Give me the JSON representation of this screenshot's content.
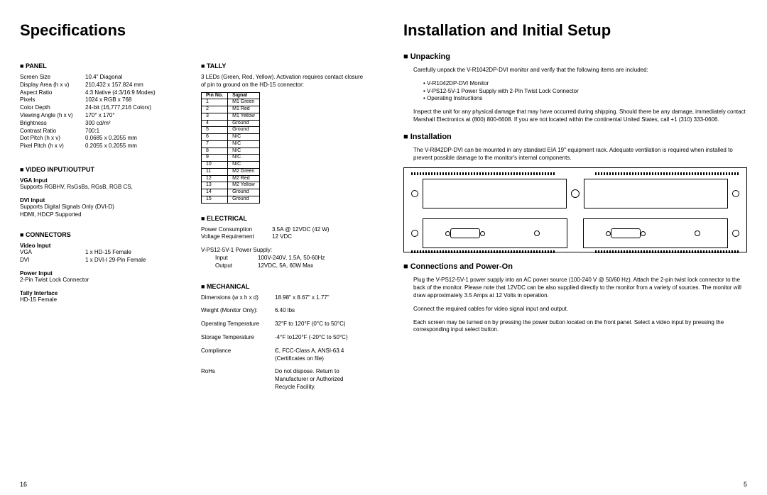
{
  "left": {
    "title": "Specifications",
    "page_num": "16",
    "panel": {
      "heading": "PANEL",
      "rows": [
        {
          "label": "Screen Size",
          "val": "10.4\" Diagonal"
        },
        {
          "label": "Display Area (h x v)",
          "val": "210.432 x 157.824 mm"
        },
        {
          "label": "Aspect Ratio",
          "val": "4:3 Native (4:3/16:9 Modes)"
        },
        {
          "label": "Pixels",
          "val": "1024 x RGB x 768"
        },
        {
          "label": "Color Depth",
          "val": "24-bit (16,777,216 Colors)"
        },
        {
          "label": "Viewing Angle (h x v)",
          "val": "170° x 170°"
        },
        {
          "label": "Brightness",
          "val": "300 cd/m²"
        },
        {
          "label": "Contrast Ratio",
          "val": "700:1"
        },
        {
          "label": "Dot Pitch (h x v)",
          "val": "0.0685 x 0.2055 mm"
        },
        {
          "label": "Pixel Pitch (h x v)",
          "val": "0.2055 x 0.2055 mm"
        }
      ]
    },
    "video_io": {
      "heading": "VIDEO INPUT/OUTPUT",
      "vga_head": "VGA Input",
      "vga_line": "Supports RGBHV, RsGsBs, RGsB, RGB CS,",
      "dvi_head": "DVI Input",
      "dvi_line1": "Supports Digital Signals Only (DVI-D)",
      "dvi_line2": "HDMI, HDCP Supported"
    },
    "connectors": {
      "heading": "CONNECTORS",
      "vi_head": "Video Input",
      "vga_row": {
        "label": "VGA",
        "val": "1 x HD-15 Female"
      },
      "dvi_row": {
        "label": "DVI",
        "val": "1 x DVI-I 29-Pin Female"
      },
      "power_head": "Power Input",
      "power_val": "2-Pin Twist Lock Connector",
      "tally_head": "Tally Interface",
      "tally_val": "HD-15 Female"
    },
    "tally": {
      "heading": "TALLY",
      "desc": "3 LEDs (Green, Red, Yellow). Activation requires contact closure of pin to ground on the HD-15 connector:",
      "th1": "Pin No.",
      "th2": "Signal",
      "rows": [
        {
          "pin": "1",
          "sig": "M1 Green"
        },
        {
          "pin": "2",
          "sig": "M1 Red"
        },
        {
          "pin": "3",
          "sig": "M1 Yellow"
        },
        {
          "pin": "4",
          "sig": "Ground"
        },
        {
          "pin": "5",
          "sig": "Ground"
        },
        {
          "pin": "6",
          "sig": "N/C"
        },
        {
          "pin": "7",
          "sig": "N/C"
        },
        {
          "pin": "8",
          "sig": "N/C"
        },
        {
          "pin": "9",
          "sig": "N/C"
        },
        {
          "pin": "10",
          "sig": "N/C"
        },
        {
          "pin": "11",
          "sig": "M2 Green"
        },
        {
          "pin": "12",
          "sig": "M2 Red"
        },
        {
          "pin": "13",
          "sig": "M2 Yellow"
        },
        {
          "pin": "14",
          "sig": "Ground"
        },
        {
          "pin": "15",
          "sig": "Ground"
        }
      ]
    },
    "electrical": {
      "heading": "ELECTRICAL",
      "rows": [
        {
          "label": "Power Consumption",
          "val": "3.5A @ 12VDC (42 W)"
        },
        {
          "label": "Voltage Requirement",
          "val": "12 VDC"
        }
      ],
      "ps_head": "V-PS12-5V-1 Power Supply:",
      "ps_rows": [
        {
          "label": "Input",
          "val": "100V-240V, 1.5A, 50-60Hz"
        },
        {
          "label": "Output",
          "val": "12VDC, 5A, 60W Max"
        }
      ]
    },
    "mechanical": {
      "heading": "MECHANICAL",
      "rows": [
        {
          "label": "Dimensions (w x h x d)",
          "val": "18.98\" x 8.67\" x 1.77\""
        },
        {
          "label": "Weight (Monitor Only):",
          "val": "6.40 lbs"
        },
        {
          "label": "Operating Temperature",
          "val": "32°F to 120°F (0°C to 50°C)"
        },
        {
          "label": "Storage Temperature",
          "val": "-4°F to120°F (-20°C to 50°C)"
        },
        {
          "label": "Compliance",
          "val": "Є, FCC-Class A, ANSI-63.4 (Certificates on file)"
        },
        {
          "label": "RoHs",
          "val": "Do not dispose. Return to Manufacturer or Authorized Recycle Facility."
        }
      ]
    }
  },
  "right": {
    "title": "Installation and Initial Setup",
    "page_num": "5",
    "unpacking": {
      "heading": "Unpacking",
      "p1": "Carefully unpack the V-R1042DP-DVI monitor and verify that the following items are included:",
      "bullets": [
        "V-R1042DP-DVI Monitor",
        "V-PS12-5V-1 Power Supply with 2-Pin Twist Lock Connector",
        "Operating Instructions"
      ],
      "p2": "Inspect the unit for any physical damage that may have occurred during shipping. Should there be any damage, immediately contact Marshall Electronics at (800) 800-6608. If you are not located within the continental United States, call +1 (310) 333-0606."
    },
    "installation": {
      "heading": "Installation",
      "p1": "The V-R842DP-DVI can be mounted in any standard EIA 19\" equipment rack. Adequate ventilation is required when installed to prevent possible damage to the monitor's internal components."
    },
    "connections": {
      "heading": "Connections and Power-On",
      "p1": "Plug the V-PS12-5V-1 power supply into an AC power source (100-240 V @ 50/60 Hz). Attach the 2-pin twist lock connector to the back of the monitor. Please note that 12VDC can be also supplied directly to the monitor from a variety of sources. The monitor will draw approximately 3.5 Amps at 12 Volts in operation.",
      "p2": "Connect the required cables for video signal input and output.",
      "p3": "Each screen may be turned on by pressing the power button located on the front panel. Select a video input by pressing the corresponding input select button."
    }
  }
}
